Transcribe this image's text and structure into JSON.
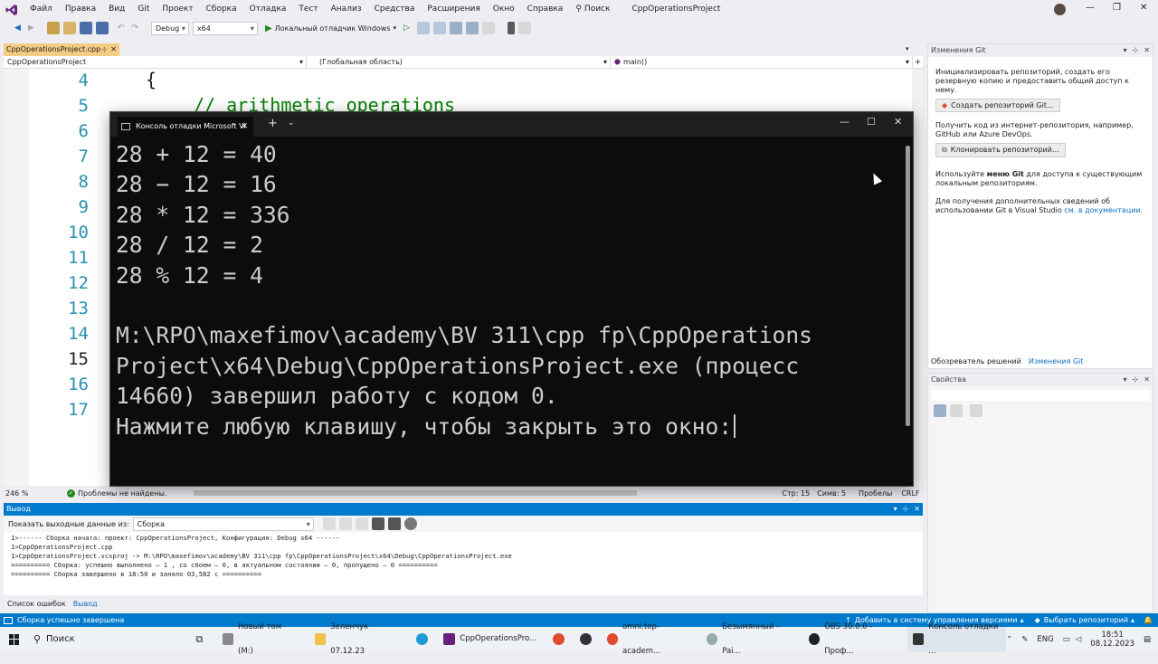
{
  "menu": {
    "items": [
      "Файл",
      "Правка",
      "Вид",
      "Git",
      "Проект",
      "Сборка",
      "Отладка",
      "Тест",
      "Анализ",
      "Средства",
      "Расширения",
      "Окно",
      "Справка"
    ],
    "search_label": "Поиск",
    "solution_title": "CppOperationsProject"
  },
  "toolbar": {
    "config": "Debug",
    "platform": "x64",
    "run_label": "Локальный отладчик Windows"
  },
  "editor": {
    "file_tab": "CppOperationsProject.cpp",
    "nav_project": "CppOperationsProject",
    "nav_scope": "(Глобальная область)",
    "nav_function": "main()",
    "line_numbers": [
      "4",
      "5",
      "6",
      "7",
      "8",
      "9",
      "10",
      "11",
      "12",
      "13",
      "14",
      "15",
      "16",
      "17"
    ],
    "code_brace": "{",
    "code_comment": "// arithmetic operations",
    "zoom": "246 %",
    "issues": "Проблемы не найдены.",
    "line": "Стр: 15",
    "col": "Симв: 5",
    "whitespace": "Пробелы",
    "eol": "CRLF"
  },
  "console": {
    "tab_title": "Консоль отладки Microsoft Vi",
    "lines": [
      "28 + 12 = 40",
      "28 − 12 = 16",
      "28 * 12 = 336",
      "28 / 12 = 2",
      "28 % 12 = 4",
      "",
      "M:\\RPO\\maxefimov\\academy\\BV 311\\cpp fp\\CppOperations",
      "Project\\x64\\Debug\\CppOperationsProject.exe (процесс",
      "14660) завершил работу с кодом 0.",
      "Нажмите любую клавишу, чтобы закрыть это окно:"
    ]
  },
  "output": {
    "title": "Вывод",
    "show_label": "Показать выходные данные из:",
    "source": "Сборка",
    "lines": [
      "1>------ Сборка начата: проект: CppOperationsProject, Конфигурация: Debug x64 ------",
      "1>CppOperationsProject.cpp",
      "1>CppOperationsProject.vcxproj -> M:\\RPO\\maxefimov\\academy\\BV 311\\cpp fp\\CppOperationsProject\\x64\\Debug\\CppOperationsProject.exe",
      "========== Сборка: успешно выполнено — 1 , со сбоем — 0, в актуальном состоянии — 0, пропущено — 0 ==========",
      "========== Сборка завершено в 18:50 и заняло 03,582 с =========="
    ],
    "tab_errors": "Список ошибок",
    "tab_output": "Вывод"
  },
  "git_panel": {
    "title": "Изменения Git",
    "text1": "Инициализировать репозиторий, создать его резервную копию и предоставить общий доступ к нему.",
    "btn_create": "Создать репозиторий Git...",
    "text2": "Получить код из интернет-репозитория, например, GitHub или Azure DevOps.",
    "btn_clone": "Клонировать репозиторий...",
    "text3_prefix": "Используйте ",
    "text3_bold": "меню Git",
    "text3_suffix": " для доступа к существующим локальным репозиториям.",
    "text4": "Для получения дополнительных сведений об использовании Git в Visual Studio ",
    "text4_link": "см. в документации.",
    "tab_solution": "Обозреватель решений",
    "tab_git": "Изменения Git"
  },
  "properties": {
    "title": "Свойства"
  },
  "statusbar": {
    "message": "Сборка успешно завершена",
    "add_vcs": "Добавить в систему управления версиями",
    "select_repo": "Выбрать репозиторий"
  },
  "taskbar": {
    "search": "Поиск",
    "items": [
      "Новый том (M:)",
      "Зеленчук 07.12.23",
      "CppOperationsPro...",
      "omni.top-academ...",
      "Безымянный - Pai...",
      "OBS 30.0.0 - Проф...",
      "Консоль отладки ..."
    ],
    "lang": "ENG",
    "time": "18:51",
    "date": "08.12.2023"
  }
}
